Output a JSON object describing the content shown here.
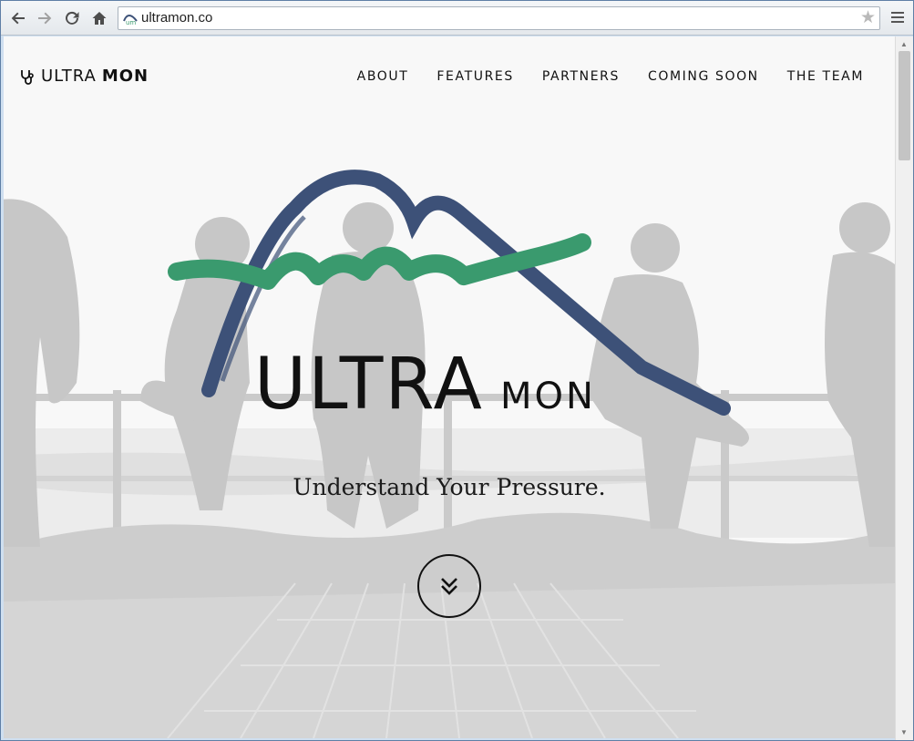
{
  "browser": {
    "url": "ultramon.co",
    "favicon_text": "um"
  },
  "site": {
    "brand_light": "ULTRA",
    "brand_bold": "MON",
    "nav": [
      {
        "label": "ABOUT"
      },
      {
        "label": "FEATURES"
      },
      {
        "label": "PARTNERS"
      },
      {
        "label": "COMING SOON"
      },
      {
        "label": "THE TEAM"
      }
    ],
    "logo": {
      "text_big": "ULTRA",
      "text_small": "MON",
      "colors": {
        "arc": "#3d5178",
        "wave": "#3a9a6e"
      }
    },
    "tagline": "Understand Your Pressure."
  },
  "icons": {
    "back": "arrow-left-icon",
    "forward": "arrow-right-icon",
    "reload": "reload-icon",
    "home": "home-icon",
    "star": "star-icon",
    "menu": "menu-icon",
    "scroll": "double-chevron-down-icon"
  }
}
